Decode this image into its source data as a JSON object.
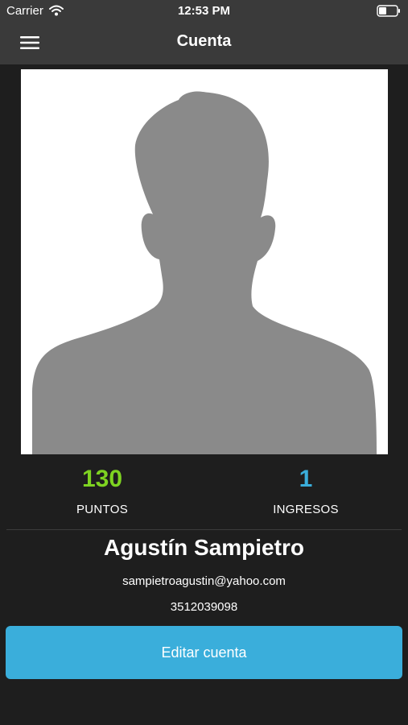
{
  "status_bar": {
    "carrier": "Carrier",
    "time": "12:53 PM",
    "wifi_icon": "wifi-icon",
    "battery_icon": "battery-icon"
  },
  "nav": {
    "title": "Cuenta",
    "menu_icon": "hamburger-menu-icon"
  },
  "profile": {
    "photo_icon": "avatar-silhouette",
    "name": "Agustín Sampietro",
    "email": "sampietroagustin@yahoo.com",
    "phone": "3512039098"
  },
  "stats": {
    "points": {
      "value": "130",
      "label": "PUNTOS"
    },
    "logins": {
      "value": "1",
      "label": "INGRESOS"
    }
  },
  "actions": {
    "edit_label": "Editar cuenta"
  },
  "colors": {
    "background": "#1e1e1e",
    "bar": "#3a3a3a",
    "points_accent": "#7ed321",
    "logins_accent": "#3aaedb",
    "button": "#3aaedb",
    "silhouette": "#8a8a8a"
  }
}
